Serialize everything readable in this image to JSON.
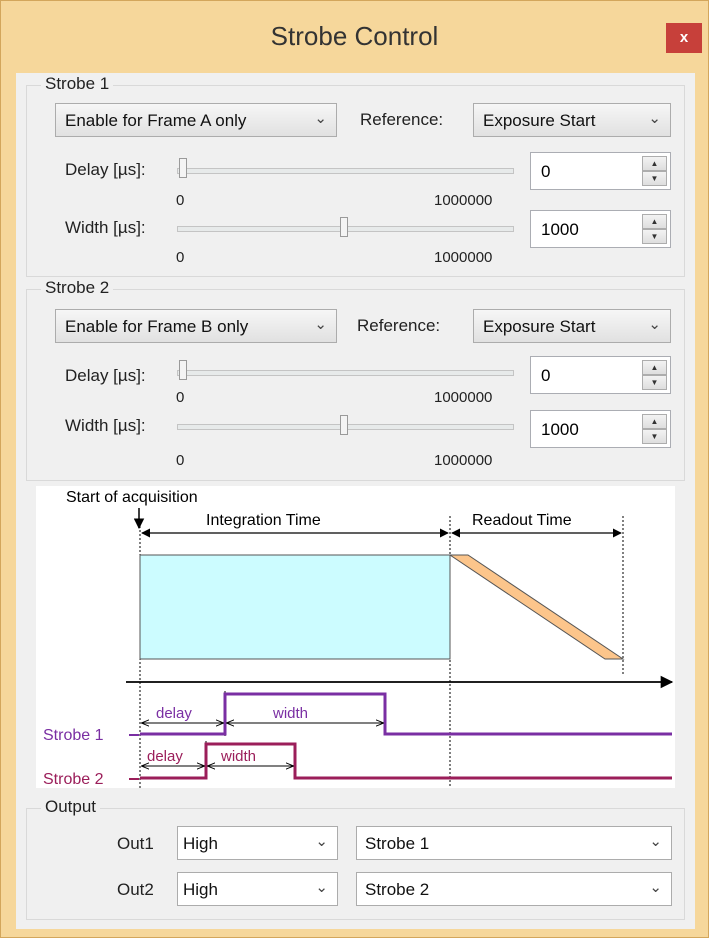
{
  "window": {
    "title": "Strobe Control",
    "close_glyph": "x",
    "close_color": "#c7403a"
  },
  "strobe1": {
    "legend": "Strobe 1",
    "mode": "Enable for Frame A only",
    "reference_label": "Reference:",
    "reference": "Exposure Start",
    "delay_label": "Delay [µs]:",
    "delay_min": "0",
    "delay_max": "1000000",
    "delay_value": "0",
    "width_label": "Width [µs]:",
    "width_min": "0",
    "width_max": "1000000",
    "width_value": "1000"
  },
  "strobe2": {
    "legend": "Strobe 2",
    "mode": "Enable for Frame B only",
    "reference_label": "Reference:",
    "reference": "Exposure Start",
    "delay_label": "Delay [µs]:",
    "delay_min": "0",
    "delay_max": "1000000",
    "delay_value": "0",
    "width_label": "Width [µs]:",
    "width_min": "0",
    "width_max": "1000000",
    "width_value": "1000"
  },
  "diagram": {
    "start_label": "Start of acquisition",
    "integration_label": "Integration Time",
    "readout_label": "Readout Time",
    "strobe1_label": "Strobe 1",
    "strobe2_label": "Strobe 2",
    "delay_text": "delay",
    "width_text": "width",
    "colors": {
      "integration_fill": "#ccfcff",
      "readout_fill": "#fcc58b",
      "strobe1": "#7a2fa3",
      "strobe2": "#9b1e5a"
    }
  },
  "output": {
    "legend": "Output",
    "rows": [
      {
        "label": "Out1",
        "level": "High",
        "source": "Strobe 1"
      },
      {
        "label": "Out2",
        "level": "High",
        "source": "Strobe 2"
      }
    ]
  }
}
